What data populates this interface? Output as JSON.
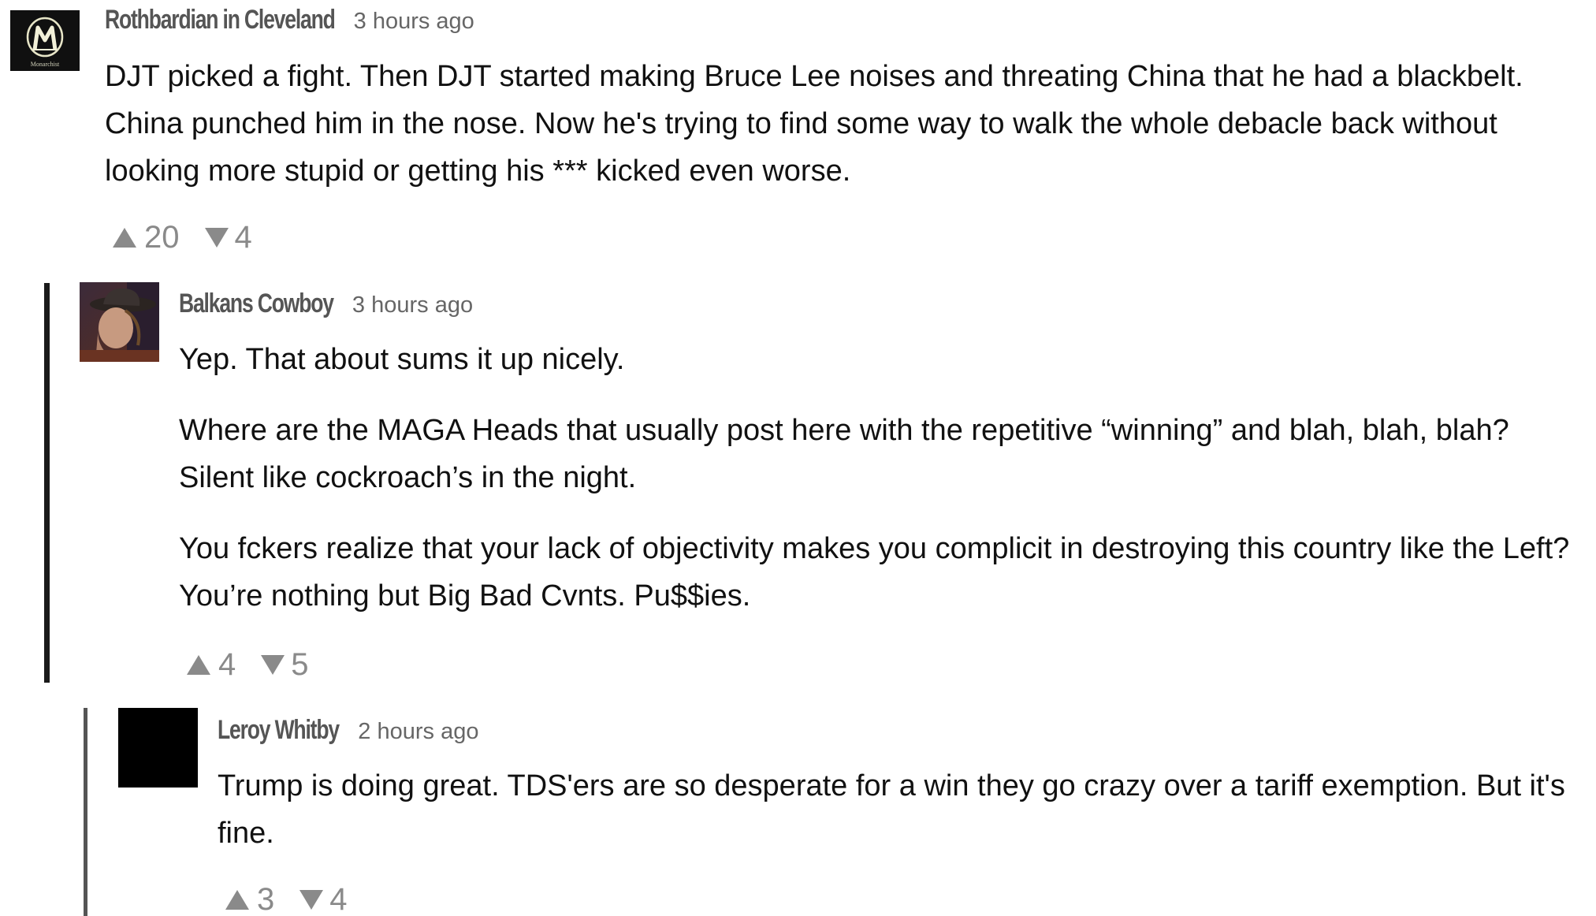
{
  "colors": {
    "author": "#555555",
    "timestamp": "#666666",
    "vote": "#8a8a8a",
    "rule_level1": "#1a1a1a",
    "rule_level2": "#555555"
  },
  "comments": [
    {
      "author": "Rothbardian in Cleveland",
      "time": "3 hours ago",
      "avatar_icon": "monarchist-logo-avatar",
      "avatar_caption": "Monarchist",
      "paragraphs": [
        "DJT picked a fight.  Then DJT started making Bruce Lee noises and threating China that he had a blackbelt.   China punched him in the nose.  Now he's trying to find some way to walk the whole debacle back without looking more stupid or getting his *** kicked even worse."
      ],
      "upvotes": "20",
      "downvotes": "4"
    },
    {
      "author": "Balkans Cowboy",
      "time": "3 hours ago",
      "avatar_icon": "cowboy-photo-avatar",
      "paragraphs": [
        "Yep. That about sums it up nicely.",
        "Where are the MAGA Heads that usually post here with the repetitive “winning” and blah, blah, blah? Silent like cockroach’s in the night.",
        "You fckers realize that your lack of objectivity makes you complicit in destroying this country like the Left? You’re nothing but Big Bad Cvnts. Pu$$ies."
      ],
      "upvotes": "4",
      "downvotes": "5"
    },
    {
      "author": "Leroy Whitby",
      "time": "2 hours ago",
      "avatar_icon": "black-square-avatar",
      "paragraphs": [
        "Trump is doing great. TDS'ers are so desperate for a win they go crazy over a tariff exemption. But it's fine."
      ],
      "upvotes": "3",
      "downvotes": "4"
    }
  ]
}
